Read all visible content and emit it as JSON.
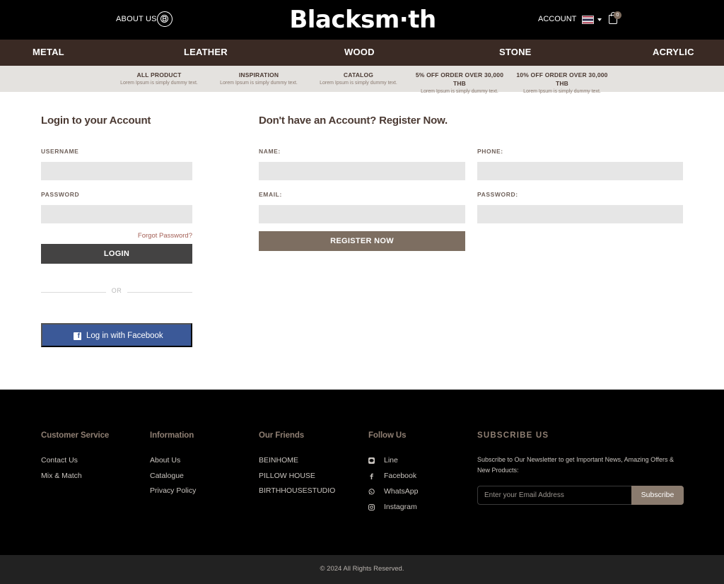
{
  "header": {
    "about_label": "ABOUT US",
    "brand": "Blacksm·th",
    "account_label": "ACCOUNT",
    "cart_count": "0",
    "flag_icon": "thai-flag-icon",
    "colors": {
      "background": "#000000",
      "cart_badge": "#7d6b5d"
    }
  },
  "categories": [
    "METAL",
    "LEATHER",
    "WOOD",
    "STONE",
    "ACRYLIC"
  ],
  "promos": [
    {
      "title": "ALL PRODUCT",
      "sub": "Lorem Ipsum is simply dummy text."
    },
    {
      "title": "INSPIRATION",
      "sub": "Lorem Ipsum is simply dummy text."
    },
    {
      "title": "CATALOG",
      "sub": "Lorem Ipsum is simply dummy text."
    },
    {
      "title": "5% OFF ORDER OVER 30,000 THB",
      "sub": "Lorem Ipsum is simply dummy text."
    },
    {
      "title": "10% OFF ORDER OVER 30,000 THB",
      "sub": "Lorem Ipsum is simply dummy text."
    }
  ],
  "login": {
    "title": "Login to your Account",
    "username_label": "USERNAME",
    "username_value": "",
    "password_label": "PASSWORD",
    "password_value": "",
    "forgot": "Forgot Password?",
    "button": "LOGIN",
    "or": "OR",
    "facebook_button": "Log in with Facebook"
  },
  "register": {
    "title": "Don't have an Account? Register Now.",
    "name_label": "NAME:",
    "phone_label": "PHONE:",
    "email_label": "EMAIL:",
    "password_label": "PASSWORD:",
    "button": "REGISTER NOW"
  },
  "footer": {
    "customer_service": {
      "title": "Customer Service",
      "links": [
        "Contact Us",
        "Mix & Match"
      ]
    },
    "information": {
      "title": "Information",
      "links": [
        "About Us",
        "Catalogue",
        "Privacy Policy"
      ]
    },
    "friends": {
      "title": "Our Friends",
      "links": [
        "BEINHOME",
        "PILLOW HOUSE",
        "BIRTHHOUSESTUDIO"
      ]
    },
    "follow": {
      "title": "Follow Us",
      "links": [
        {
          "label": "Line",
          "icon": "line-icon"
        },
        {
          "label": "Facebook",
          "icon": "facebook-icon"
        },
        {
          "label": "WhatsApp",
          "icon": "whatsapp-icon"
        },
        {
          "label": "Instagram",
          "icon": "instagram-icon"
        }
      ]
    },
    "subscribe": {
      "title": "SUBSCRIBE US",
      "text": "Subscribe to Our Newsletter to get Important News, Amazing Offers & New Products:",
      "placeholder": "Enter your Email Address",
      "button": "Subscribe"
    },
    "copyright": "© 2024 All Rights Reserved."
  }
}
